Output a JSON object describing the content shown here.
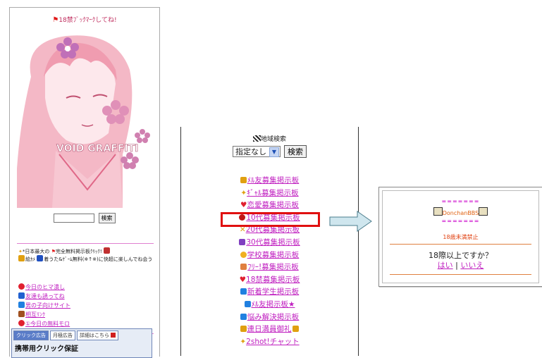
{
  "left_panel": {
    "bookmark_text": "18禁ﾌﾞｯｸﾏｰｸしてね!",
    "art_text": "VOID GRAFFITI",
    "search_placeholder": "",
    "search_button": "検索",
    "promo": [
      "*日本最大の",
      "完全無料掲示板ｸﾘｯｸ!",
      "絵ｶﾒ",
      "着うた&ｹﾞｰﾑ無料(※↑※)に快超に楽しんでね会う"
    ],
    "links": [
      {
        "label": "今日のヒマ潰し",
        "icon": "heart-icon",
        "color": "#e02030"
      },
      {
        "label": "友達も誘ってね",
        "icon": "people-icon",
        "color": "#2060d0"
      },
      {
        "label": "男の子向けサイト",
        "icon": "pencil-icon",
        "color": "#2080e0"
      },
      {
        "label": "相互ﾘﾝｸ",
        "icon": "box-icon",
        "color": "#a05020"
      },
      {
        "label": "①今日の無料モロ",
        "icon": "heart-icon",
        "color": "#e02030"
      }
    ],
    "ad_tabs": [
      "クリック広告",
      "月極広告",
      "詳細はこちら"
    ],
    "ad_body": "携帯用クリック保証"
  },
  "middle_panel": {
    "geo_label": "地域検索",
    "select_value": "指定なし",
    "search_button": "検索",
    "boards": [
      {
        "label": "ﾒﾙ友募集掲示板",
        "icon": "people-icon",
        "color": "#e0a010"
      },
      {
        "label": "ｷﾞｬﾙ募集掲示板",
        "icon": "sparkle-icon",
        "color": "#e0a010"
      },
      {
        "label": "恋愛募集掲示板",
        "icon": "heart-icon",
        "color": "#e02030"
      },
      {
        "label": "10代募集掲示板",
        "icon": "apple-icon",
        "color": "#c01818"
      },
      {
        "label": "20代募集掲示板",
        "icon": "star-icon",
        "color": "#e0a010"
      },
      {
        "label": "30代募集掲示板",
        "icon": "ribbon-icon",
        "color": "#8040c0"
      },
      {
        "label": "学校募集掲示板",
        "icon": "face-icon",
        "color": "#f0b020"
      },
      {
        "label": "ﾌﾘｰ!募集掲示板",
        "icon": "book-icon",
        "color": "#e08040"
      },
      {
        "label": "18禁募集掲示板",
        "icon": "heart-icon",
        "color": "#e02030"
      },
      {
        "label": "新着学生掲示板",
        "icon": "pencil-icon",
        "color": "#2080e0"
      },
      {
        "label": "ﾒﾙ友掲示板★",
        "icon": "pencil-icon",
        "color": "#2080e0"
      },
      {
        "label": "悩み解決掲示板",
        "icon": "pencil-icon",
        "color": "#2080e0"
      },
      {
        "label": "連日満員御礼",
        "icon": "people-icon",
        "color": "#e0a010"
      },
      {
        "label": "2shot!チャット",
        "icon": "sparkle-icon",
        "color": "#e0a010"
      }
    ],
    "highlight_color": "#e01010"
  },
  "dialog": {
    "eq_line": "=======",
    "title": "DonchanBBS",
    "age_notice": "18歳未満禁止",
    "question": "18際以上ですか？",
    "yes": "はい",
    "separator": "|",
    "no": "いいえ"
  }
}
